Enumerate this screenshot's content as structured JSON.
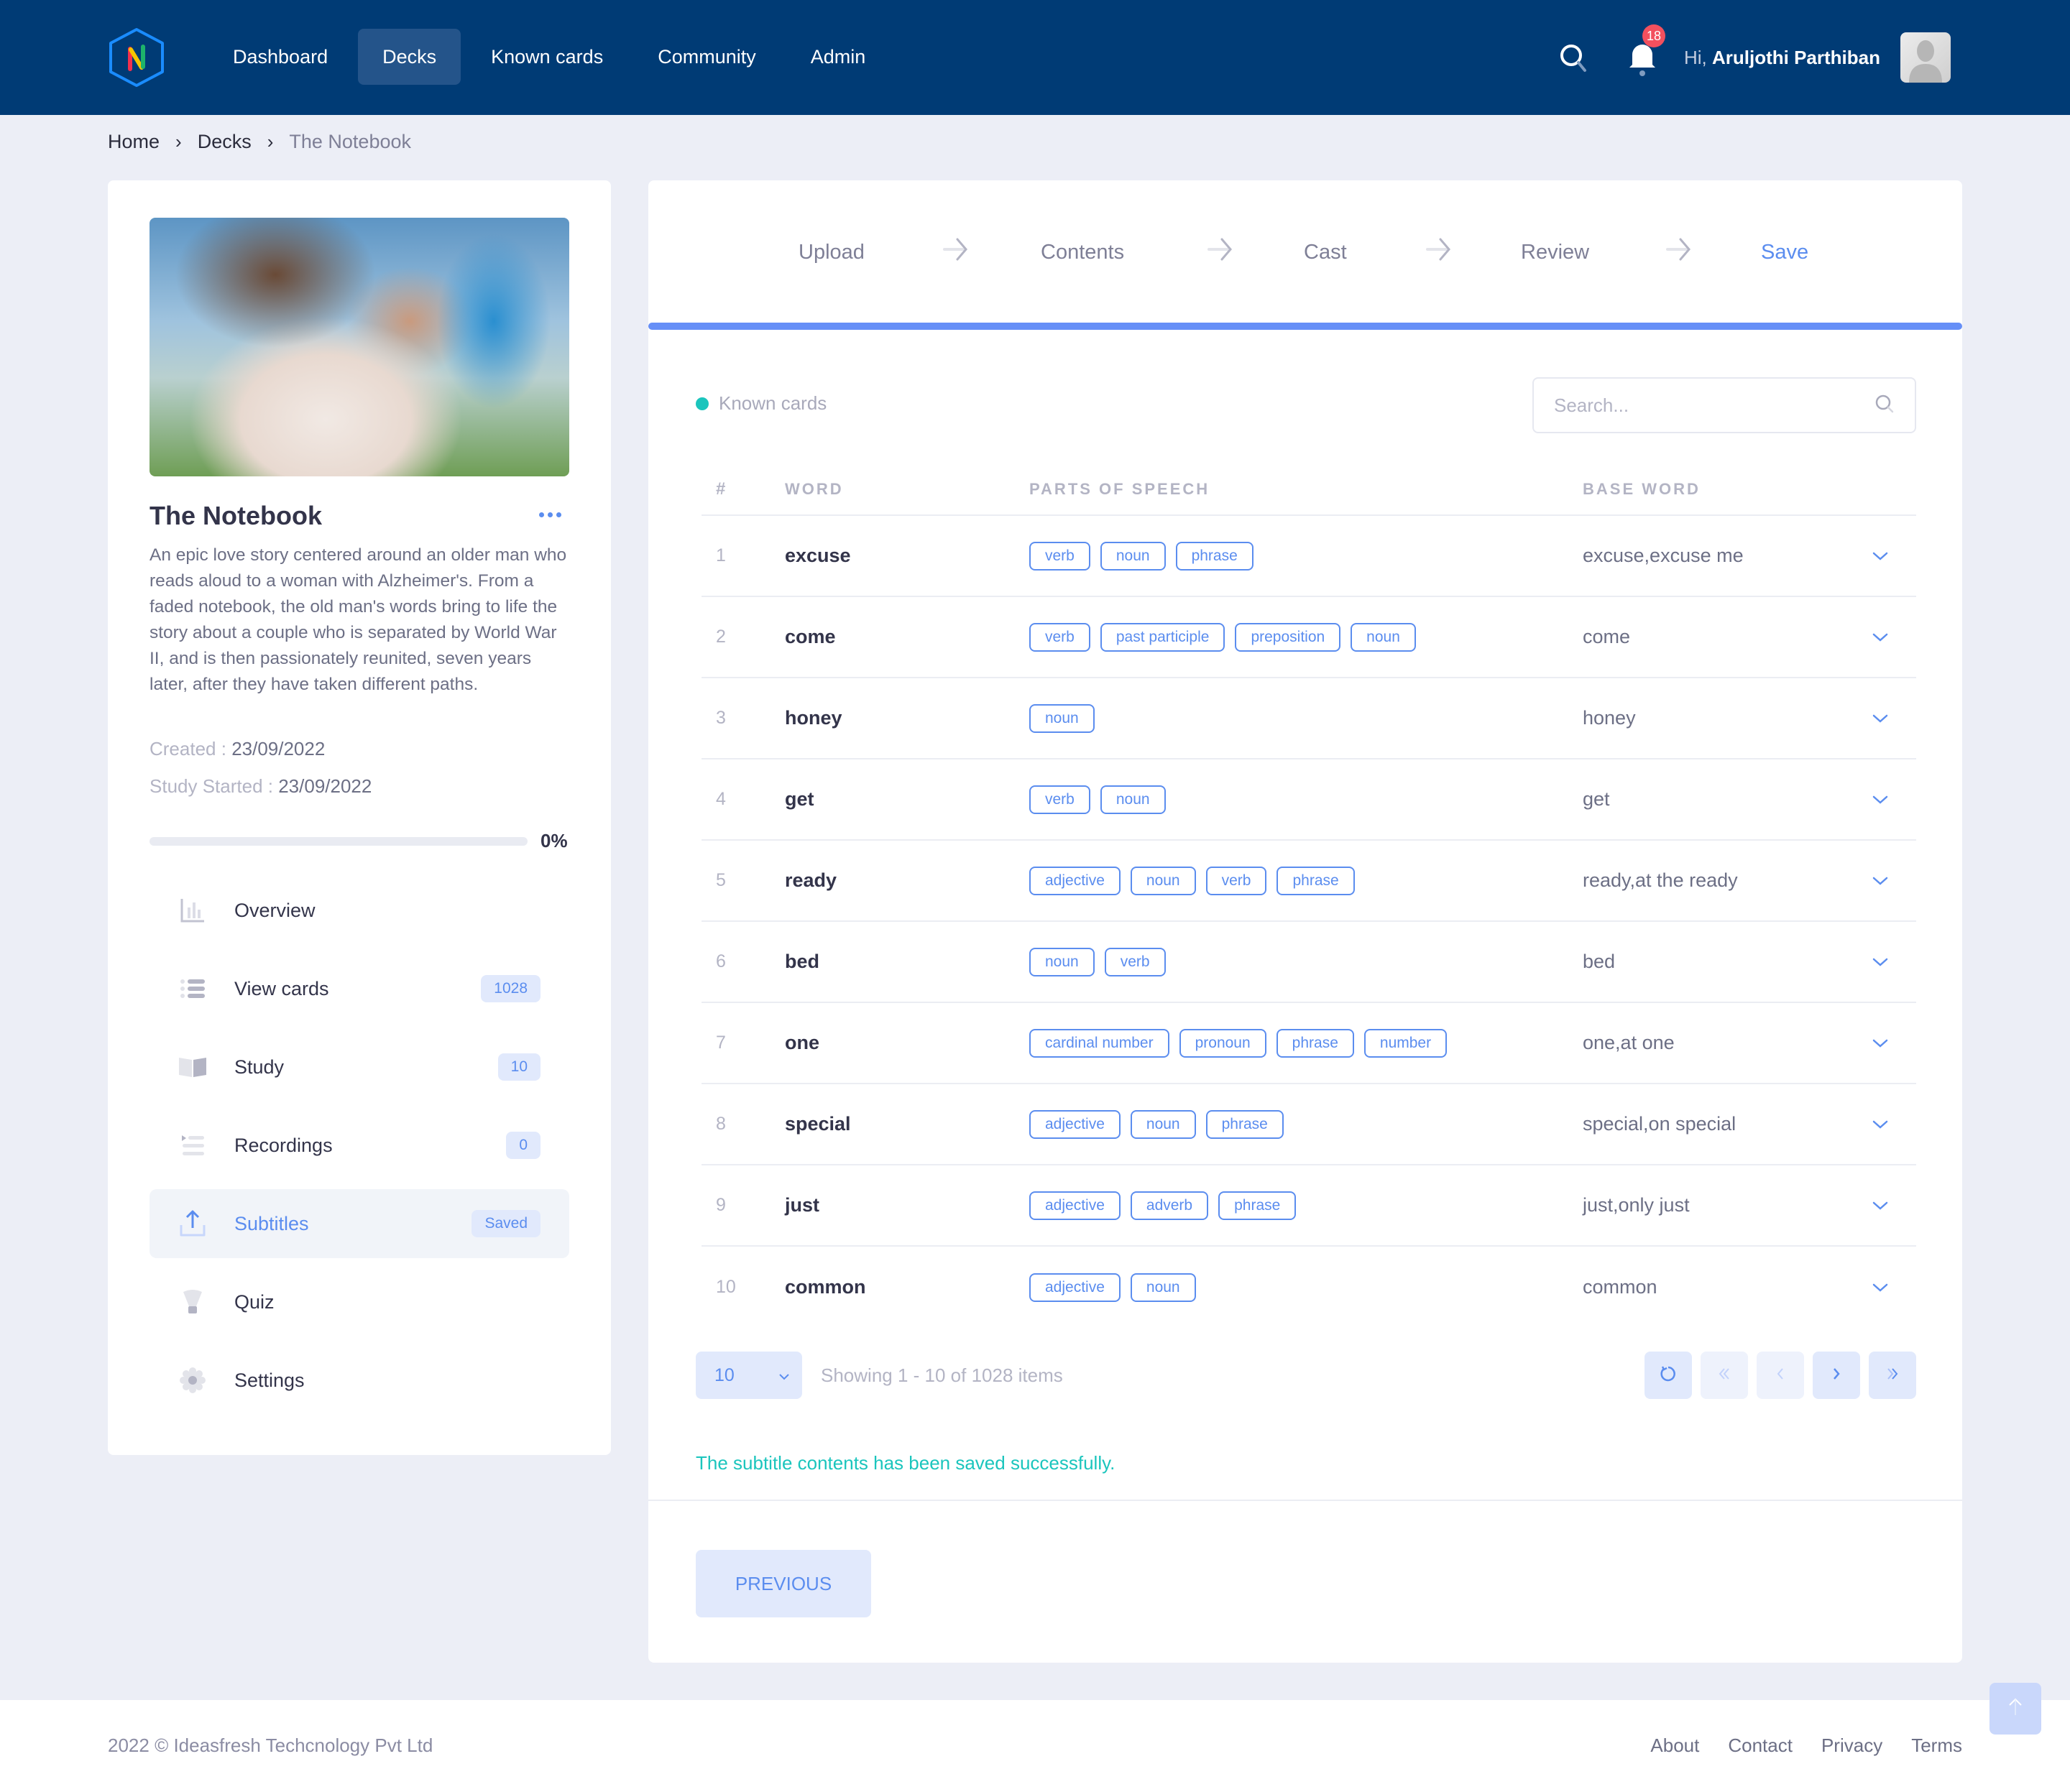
{
  "topbar": {
    "logo_letter": "N",
    "nav": [
      {
        "label": "Dashboard",
        "active": false
      },
      {
        "label": "Decks",
        "active": true
      },
      {
        "label": "Known cards",
        "active": false
      },
      {
        "label": "Community",
        "active": false
      },
      {
        "label": "Admin",
        "active": false
      }
    ],
    "notification_count": "18",
    "greeting_prefix": "Hi,",
    "user_name": "Aruljothi Parthiban"
  },
  "breadcrumb": [
    "Home",
    "Decks",
    "The Notebook"
  ],
  "deck": {
    "title": "The Notebook",
    "description": "An epic love story centered around an older man who reads aloud to a woman with Alzheimer's. From a faded notebook, the old man's words bring to life the story about a couple who is separated by World War II, and is then passionately reunited, seven years later, after they have taken different paths.",
    "created_label": "Created :",
    "created_value": "23/09/2022",
    "study_started_label": "Study Started :",
    "study_started_value": "23/09/2022",
    "progress_percent": 0,
    "progress_label": "0%"
  },
  "menu": [
    {
      "label": "Overview",
      "icon": "bar-chart-icon",
      "badge": null,
      "active": false
    },
    {
      "label": "View cards",
      "icon": "list-icon",
      "badge": "1028",
      "active": false
    },
    {
      "label": "Study",
      "icon": "book-open-icon",
      "badge": "10",
      "active": false
    },
    {
      "label": "Recordings",
      "icon": "playlist-icon",
      "badge": "0",
      "active": false
    },
    {
      "label": "Subtitles",
      "icon": "upload-icon",
      "badge": "Saved",
      "active": true
    },
    {
      "label": "Quiz",
      "icon": "lightbulb-icon",
      "badge": null,
      "active": false
    },
    {
      "label": "Settings",
      "icon": "gear-icon",
      "badge": null,
      "active": false
    }
  ],
  "stepper": {
    "steps": [
      "Upload",
      "Contents",
      "Cast",
      "Review",
      "Save"
    ],
    "active_index": 4
  },
  "main": {
    "legend_label": "Known cards",
    "search_placeholder": "Search...",
    "search_value": "",
    "columns": {
      "num": "#",
      "word": "WORD",
      "pos": "PARTS OF SPEECH",
      "base": "BASE WORD"
    },
    "rows": [
      {
        "num": "1",
        "word": "excuse",
        "pos": [
          "verb",
          "noun",
          "phrase"
        ],
        "base": "excuse,excuse me"
      },
      {
        "num": "2",
        "word": "come",
        "pos": [
          "verb",
          "past participle",
          "preposition",
          "noun"
        ],
        "base": "come"
      },
      {
        "num": "3",
        "word": "honey",
        "pos": [
          "noun"
        ],
        "base": "honey"
      },
      {
        "num": "4",
        "word": "get",
        "pos": [
          "verb",
          "noun"
        ],
        "base": "get"
      },
      {
        "num": "5",
        "word": "ready",
        "pos": [
          "adjective",
          "noun",
          "verb",
          "phrase"
        ],
        "base": "ready,at the ready"
      },
      {
        "num": "6",
        "word": "bed",
        "pos": [
          "noun",
          "verb"
        ],
        "base": "bed"
      },
      {
        "num": "7",
        "word": "one",
        "pos": [
          "cardinal number",
          "pronoun",
          "phrase",
          "number"
        ],
        "base": "one,at one"
      },
      {
        "num": "8",
        "word": "special",
        "pos": [
          "adjective",
          "noun",
          "phrase"
        ],
        "base": "special,on special"
      },
      {
        "num": "9",
        "word": "just",
        "pos": [
          "adjective",
          "adverb",
          "phrase"
        ],
        "base": "just,only just"
      },
      {
        "num": "10",
        "word": "common",
        "pos": [
          "adjective",
          "noun"
        ],
        "base": "common"
      }
    ],
    "page_size": "10",
    "page_info": "Showing 1 - 10 of 1028 items",
    "success_message": "The subtitle contents has been saved successfully.",
    "previous_label": "PREVIOUS"
  },
  "footer": {
    "copyright": "2022 © Ideasfresh Techcnology Pvt Ltd",
    "links": [
      "About",
      "Contact",
      "Privacy",
      "Terms"
    ]
  },
  "colors": {
    "topbar": "#003b75",
    "accent": "#5b8def",
    "success": "#1bc5bd",
    "badge_bg": "#e1e9fc",
    "notification": "#f2505e"
  }
}
